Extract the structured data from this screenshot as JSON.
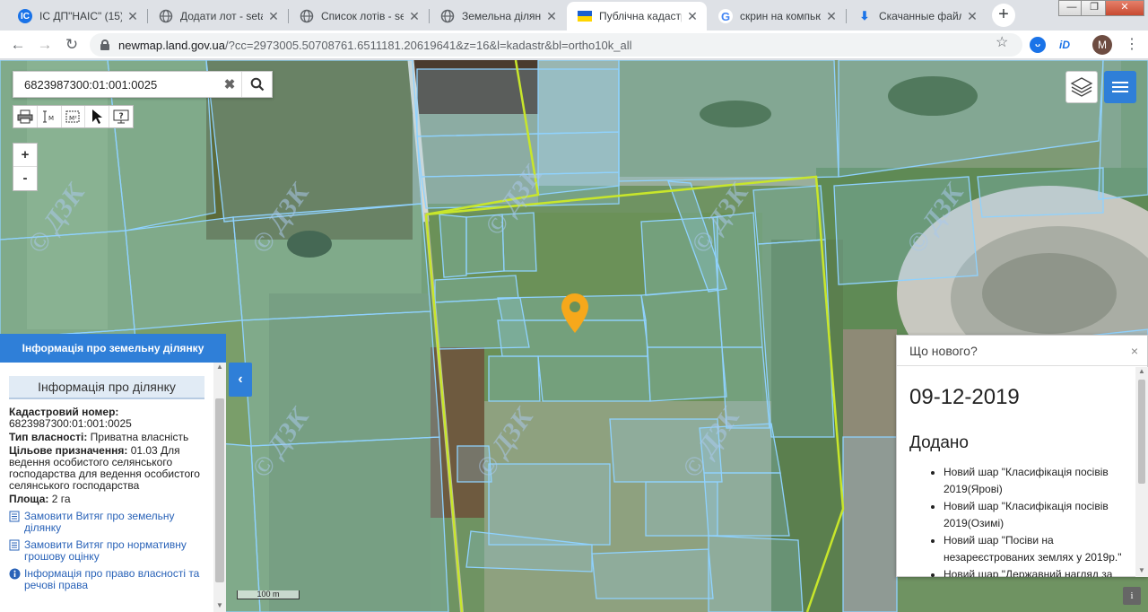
{
  "browser": {
    "tabs": [
      {
        "title": "ІС ДП\"НАІС\" (15)",
        "favicon": "ic-favicon",
        "color": "#1a73e8",
        "glyph": "ІС"
      },
      {
        "title": "Додати лот - setam",
        "favicon": "globe-icon",
        "color": "#5f6368",
        "glyph": ""
      },
      {
        "title": "Список лотів - seta",
        "favicon": "globe-icon",
        "color": "#5f6368",
        "glyph": ""
      },
      {
        "title": "Земельна ділянка",
        "favicon": "globe-icon",
        "color": "#5f6368",
        "glyph": ""
      },
      {
        "title": "Публічна кадастр",
        "favicon": "ukraine-flag-icon",
        "color": "#ffd500",
        "glyph": ""
      },
      {
        "title": "скрин на компьют",
        "favicon": "google-icon",
        "color": "#4285f4",
        "glyph": "G"
      },
      {
        "title": "Скачанные файлы",
        "favicon": "download-icon",
        "color": "#1a73e8",
        "glyph": "⬇"
      }
    ],
    "active_tab_index": 4,
    "url_main": "newmap.land.gov.ua",
    "url_rest": "/?cc=2973005.50708761.6511181.20619641&z=16&l=kadastr&bl=ortho10k_all",
    "avatar_letter": "M",
    "window_buttons": {
      "minimize": "—",
      "maximize": "❐",
      "close": "✕"
    }
  },
  "map": {
    "search": {
      "value": "6823987300:01:001:0025",
      "clear": "✖"
    },
    "zoom": {
      "in": "+",
      "out": "-"
    },
    "scale_label": "100 m",
    "watermark_text": "© ДЗК",
    "pin_color": "#f6a81b"
  },
  "info_panel": {
    "header": "Інформація про земельну ділянку",
    "subheader": "Інформація про ділянку",
    "cadastral_label": "Кадастровий номер:",
    "cadastral_value": "6823987300:01:001:0025",
    "ownership_label": "Тип власності:",
    "ownership_value": "Приватна власність",
    "purpose_label": "Цільове призначення:",
    "purpose_value": "01.03 Для ведення особистого селянського господарства для ведення особистого селянського господарства",
    "area_label": "Площа:",
    "area_value": "2 га",
    "links": [
      {
        "text": "Замовити Витяг про земельну ділянку",
        "icon": "document-icon"
      },
      {
        "text": "Замовити Витяг про нормативну грошову оцінку",
        "icon": "document-icon"
      },
      {
        "text": "Інформація про право власності та речові права",
        "icon": "info-icon"
      }
    ],
    "collapse": "‹"
  },
  "news_panel": {
    "title": "Що нового?",
    "close": "×",
    "date": "09-12-2019",
    "section": "Додано",
    "items": [
      "Новий шар \"Класифікація посівів 2019(Ярові)",
      "Новий шар \"Класифікація посівів 2019(Озимі)",
      "Новий шар \"Посіви на незареєстрованих землях у 2019р.\"",
      "Новий шар \"Державний нагляд за"
    ]
  },
  "colors": {
    "accent": "#2f7fd8",
    "parcel_line": "#8fd2ff",
    "boundary_line": "#c8e62b"
  }
}
